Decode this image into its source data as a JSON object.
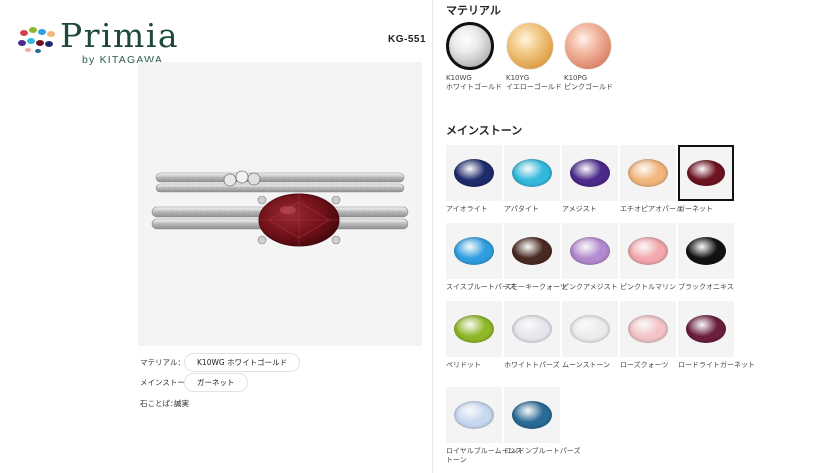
{
  "brand": {
    "name": "Primia",
    "tagline": "by KITAGAWA"
  },
  "product": {
    "code": "KG-551",
    "gem_color": "#6f1018"
  },
  "specs": {
    "material_label": "マテリアル：",
    "material_value": "K10WG ホワイトゴールド",
    "stone_label": "メインストーン：",
    "stone_value": "ガーネット",
    "meaning_label": "石ことば：",
    "meaning_value": "誠実"
  },
  "material_section": {
    "title": "マテリアル",
    "options": [
      {
        "code": "K10WG",
        "name": "ホワイトゴールド",
        "selected": true,
        "color": "#d9d9d9"
      },
      {
        "code": "K10YG",
        "name": "イエローゴールド",
        "selected": false,
        "color": "#e9b66a"
      },
      {
        "code": "K10PG",
        "name": "ピンクゴールド",
        "selected": false,
        "color": "#e69a80"
      }
    ]
  },
  "stone_section": {
    "title": "メインストーン",
    "stones": [
      {
        "name": "アイオライト",
        "color": "#1e2a6b",
        "selected": false
      },
      {
        "name": "アパタイト",
        "color": "#33b9dd",
        "selected": false
      },
      {
        "name": "アメジスト",
        "color": "#4b2a8c",
        "selected": false
      },
      {
        "name": "エチオピアオパール",
        "color": "#f3b67c",
        "selected": false
      },
      {
        "name": "ガーネット",
        "color": "#6e1320",
        "selected": true
      },
      {
        "name": "スイスブルートパーズ",
        "color": "#2f9fe0",
        "selected": false
      },
      {
        "name": "スモーキークォーツ",
        "color": "#4a2a22",
        "selected": false
      },
      {
        "name": "ピンクアメジスト",
        "color": "#b48ad0",
        "selected": false
      },
      {
        "name": "ピンクトルマリン",
        "color": "#f2a8ad",
        "selected": false
      },
      {
        "name": "ブラックオニキス",
        "color": "#121212",
        "selected": false
      },
      {
        "name": "ペリドット",
        "color": "#8fb828",
        "selected": false
      },
      {
        "name": "ホワイトトパーズ",
        "color": "#e6e6ec",
        "selected": false
      },
      {
        "name": "ムーンストーン",
        "color": "#ececec",
        "selected": false
      },
      {
        "name": "ローズクォーツ",
        "color": "#f2c4c8",
        "selected": false
      },
      {
        "name": "ロードライトガーネット",
        "color": "#6b1e3e",
        "selected": false
      },
      {
        "name": "ロイヤルブルームーンストーン",
        "color": "#c8d8f0",
        "selected": false
      },
      {
        "name": "ロンドンブルートパーズ",
        "color": "#2a6b96",
        "selected": false
      }
    ]
  }
}
